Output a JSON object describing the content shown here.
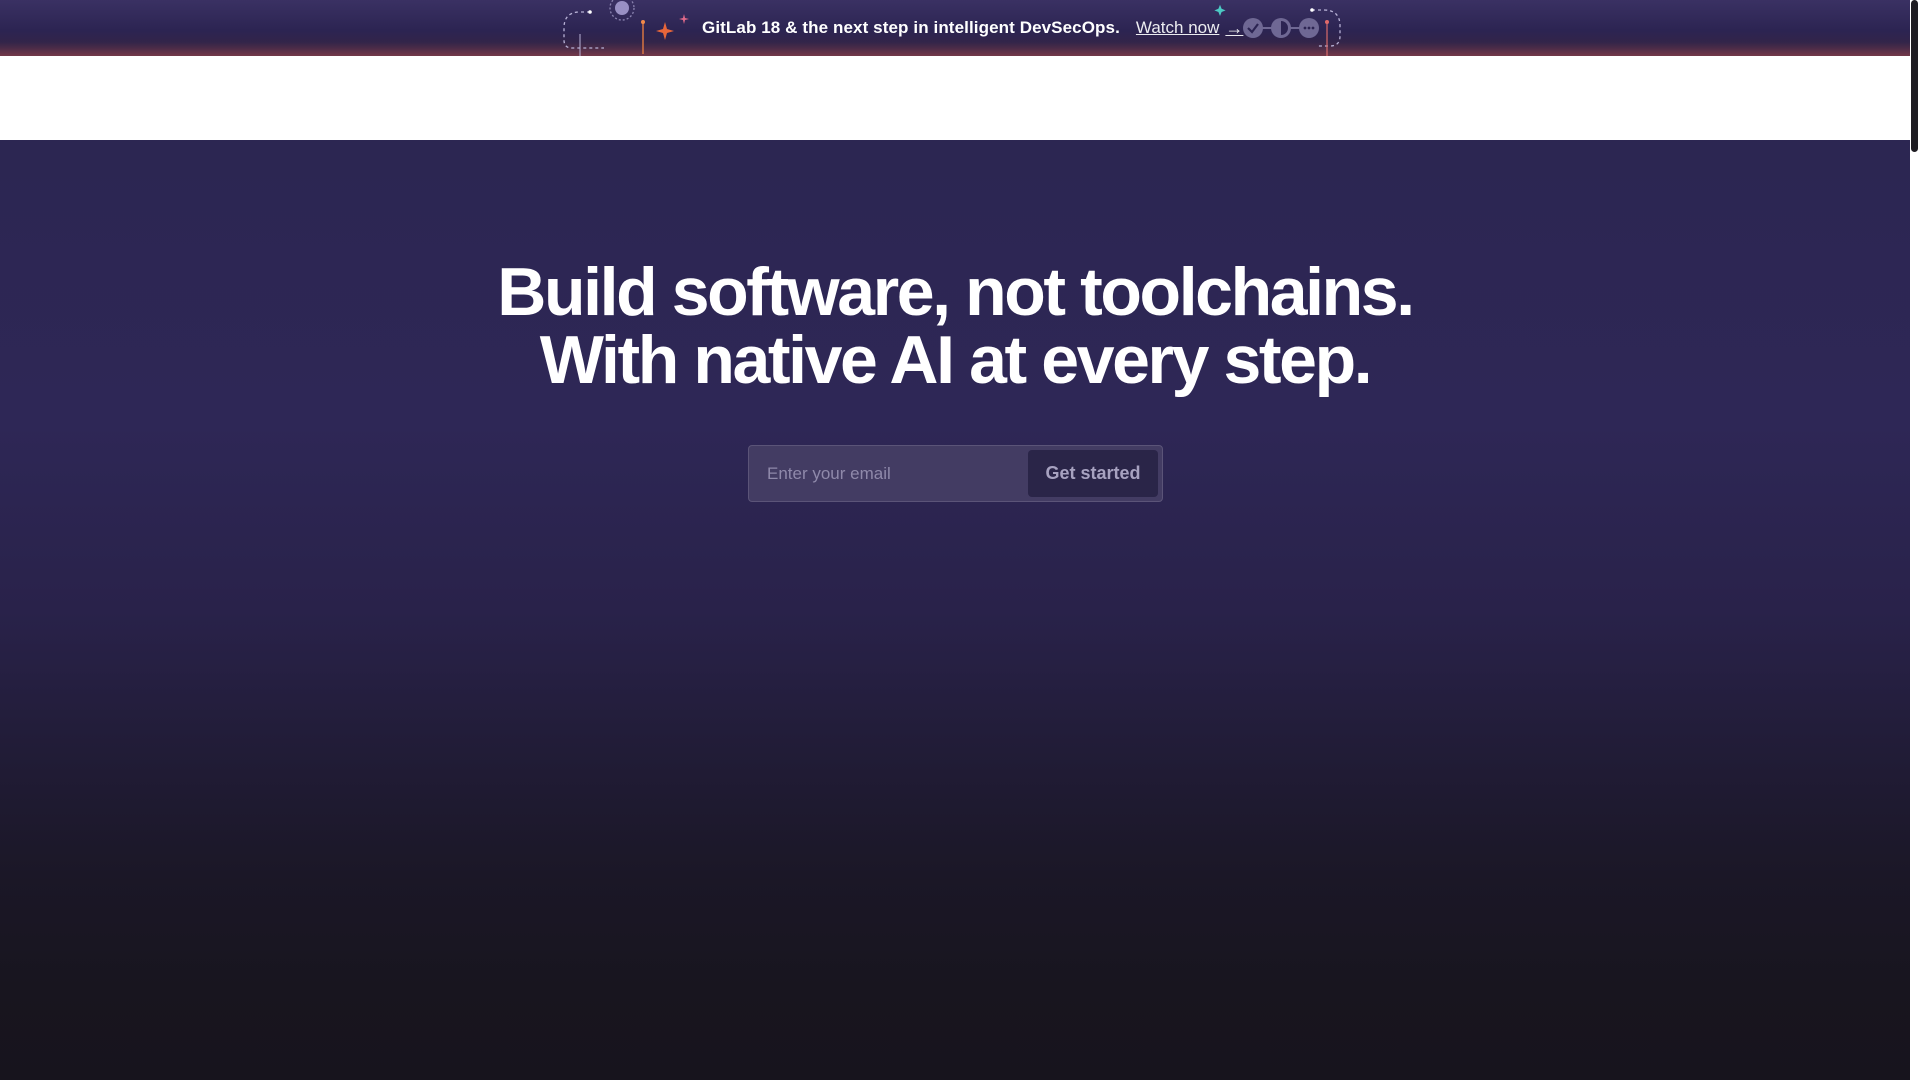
{
  "banner": {
    "text": "GitLab 18 & the next step in intelligent DevSecOps.",
    "link_label": "Watch now",
    "link_arrow": "→",
    "decorations": [
      "sparkle-icon",
      "check-circle-icon",
      "half-circle-icon",
      "dots-circle-icon"
    ]
  },
  "hero": {
    "title_line_1": "Build software, not toolchains.",
    "title_line_2": "With native AI at every step.",
    "email_placeholder": "Enter your email",
    "cta_label": "Get started"
  },
  "colors": {
    "banner_bg": "#2c2452",
    "hero_top": "#2c2652",
    "hero_bottom": "#17141d",
    "accent_orange": "#e24329",
    "accent_teal": "#4cc9c4",
    "input_bg": "#433c63",
    "button_bg": "#2a2548"
  }
}
